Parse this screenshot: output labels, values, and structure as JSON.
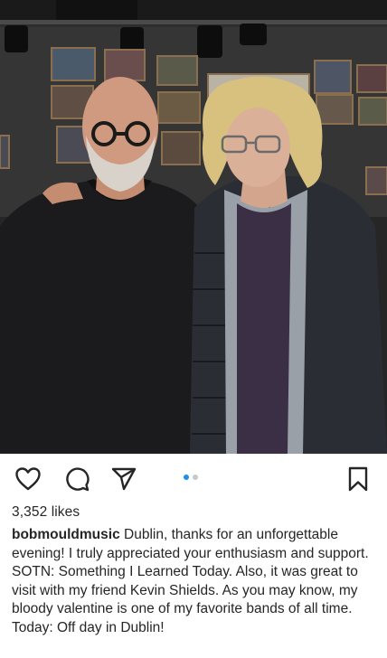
{
  "post": {
    "likes_text": "3,352 likes",
    "username": "bobmouldmusic",
    "caption": "Dublin, thanks for an unforgettable evening! I truly appreciated your enthusiasm and support. SOTN: Something I Learned Today. Also, it was great to visit with my friend Kevin Shields. As you may know, my bloody valentine is one of my favorite bands of all time. Today: Off day in Dublin!",
    "carousel": {
      "count": 2,
      "active_index": 0
    }
  },
  "actions": {
    "like_icon": "heart-outline-icon",
    "comment_icon": "comment-bubble-icon",
    "share_icon": "paper-plane-icon",
    "save_icon": "bookmark-outline-icon"
  },
  "colors": {
    "text": "#262626",
    "carousel_active": "#1c8ff2",
    "carousel_inactive": "#c7c7c7"
  }
}
